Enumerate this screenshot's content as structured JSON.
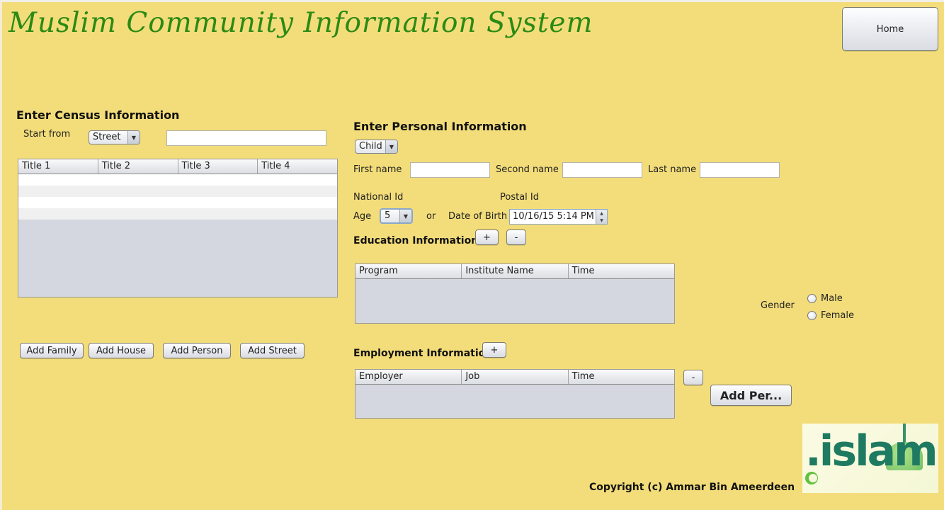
{
  "app": {
    "title": "Muslim Community Information System",
    "home_label": "Home"
  },
  "census": {
    "heading": "Enter Census Information",
    "start_from_label": "Start from",
    "start_from_value": "Street",
    "search_value": "",
    "table": {
      "columns": [
        "Title 1",
        "Title 2",
        "Title 3",
        "Title 4"
      ],
      "rows": [
        [
          "",
          "",
          "",
          ""
        ],
        [
          "",
          "",
          "",
          ""
        ],
        [
          "",
          "",
          "",
          ""
        ],
        [
          "",
          "",
          "",
          ""
        ]
      ]
    },
    "buttons": {
      "add_family": "Add Family",
      "add_house": "Add House",
      "add_person": "Add Person",
      "add_street": "Add Street"
    }
  },
  "personal": {
    "heading": "Enter Personal Information",
    "person_type_value": "Child",
    "first_name_label": "First name",
    "first_name_value": "",
    "second_name_label": "Second name",
    "second_name_value": "",
    "last_name_label": "Last name",
    "last_name_value": "",
    "national_id_label": "National Id",
    "postal_id_label": "Postal Id",
    "age_label": "Age",
    "age_value": "5",
    "or_label": "or",
    "dob_label": "Date of Birth",
    "dob_value": "10/16/15 5:14 PM",
    "gender_label": "Gender",
    "gender_options": [
      "Male",
      "Female"
    ],
    "education": {
      "heading": "Education Information",
      "add_label": "+",
      "remove_label": "-",
      "columns": [
        "Program",
        "Institute Name",
        "Time"
      ]
    },
    "employment": {
      "heading": "Employment Information",
      "add_label": "+",
      "remove_label": "-",
      "columns": [
        "Employer",
        "Job",
        "Time"
      ]
    },
    "submit_label": "Add Per..."
  },
  "logo": {
    "text": ".islam"
  },
  "footer": {
    "copyright": "Copyright (c) Ammar Bin Ameerdeen"
  },
  "colors": {
    "background": "#f3dd7a",
    "title_green": "#2a8a14",
    "table_empty": "#d4d7df"
  }
}
